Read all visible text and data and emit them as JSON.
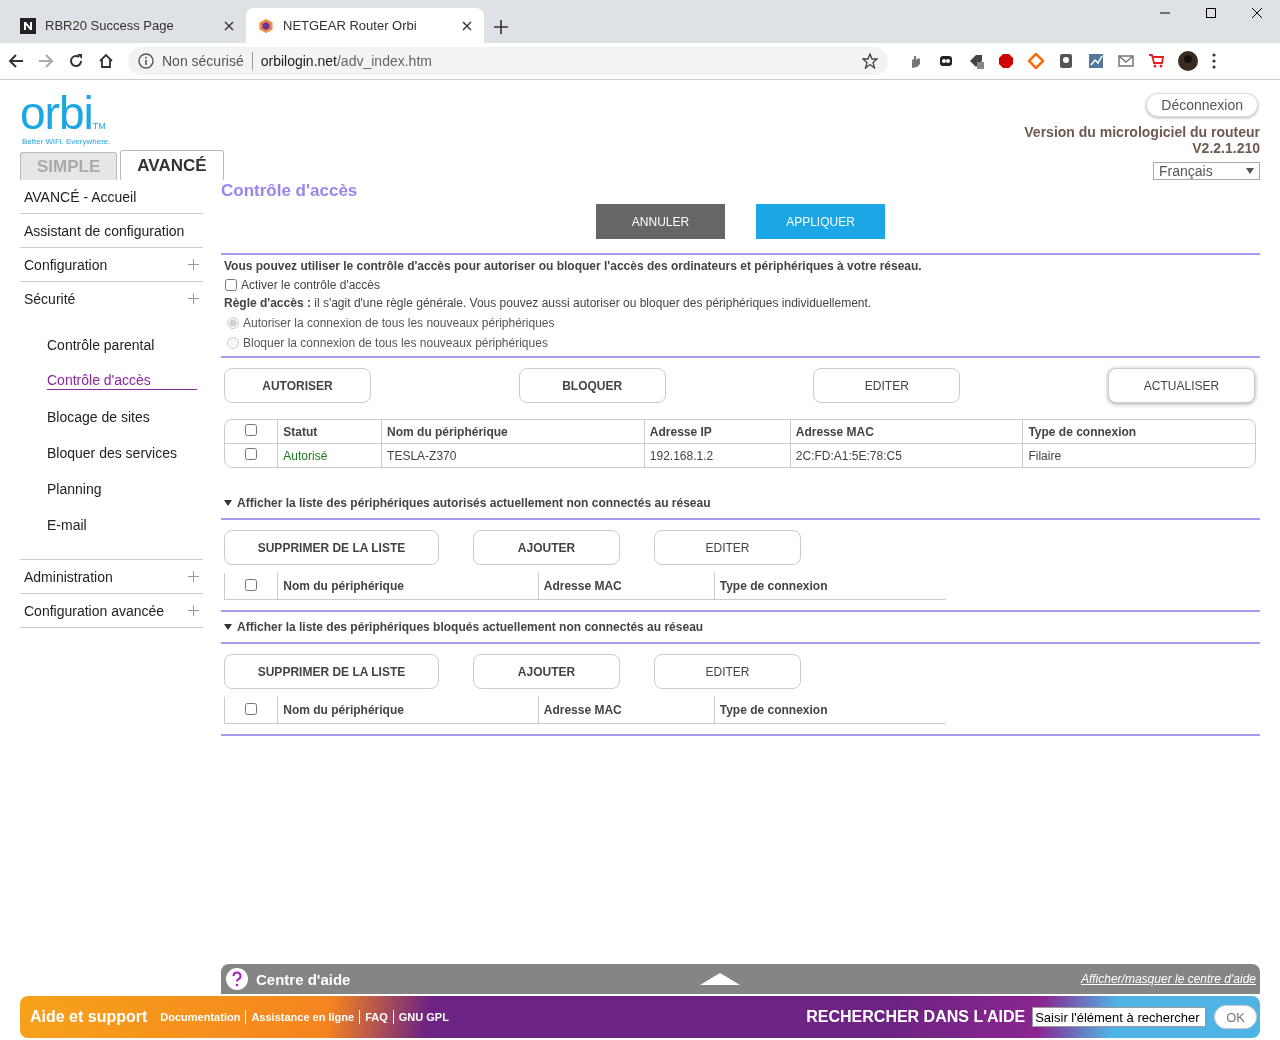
{
  "browser": {
    "tabs": [
      {
        "title": "RBR20 Success Page",
        "selected": false
      },
      {
        "title": "NETGEAR Router Orbi",
        "selected": true
      }
    ],
    "address": {
      "security": "Non sécurisé",
      "host": "orbilogin.net",
      "path": "/adv_index.htm"
    }
  },
  "header": {
    "logo": "orbi",
    "trademark": "TM",
    "tagline": "Better WiFi. Everywhere.",
    "logout": "Déconnexion",
    "firmware_label": "Version du micrologiciel du routeur",
    "firmware_version": "V2.2.1.210",
    "language": "Français"
  },
  "mode_tabs": [
    {
      "label": "SIMPLE",
      "selected": false
    },
    {
      "label": "AVANCÉ",
      "selected": true
    }
  ],
  "sidebar": {
    "items": [
      {
        "label": "AVANCÉ - Accueil",
        "expandable": false,
        "selected": false
      },
      {
        "label": "Assistant de configuration",
        "expandable": false,
        "selected": false
      },
      {
        "label": "Configuration",
        "expandable": true,
        "selected": false
      },
      {
        "label": "Sécurité",
        "expandable": true,
        "selected": false,
        "children": [
          {
            "label": "Contrôle parental",
            "selected": false
          },
          {
            "label": "Contrôle d'accès",
            "selected": true
          },
          {
            "label": "Blocage de sites",
            "selected": false
          },
          {
            "label": "Bloquer des services",
            "selected": false
          },
          {
            "label": "Planning",
            "selected": false
          },
          {
            "label": "E-mail",
            "selected": false
          }
        ]
      },
      {
        "label": "Administration",
        "expandable": true,
        "selected": false
      },
      {
        "label": "Configuration avancée",
        "expandable": true,
        "selected": false
      }
    ]
  },
  "main": {
    "title": "Contrôle d'accès",
    "top_buttons": [
      {
        "label": "ANNULER",
        "kind": "dark"
      },
      {
        "label": "APPLIQUER",
        "kind": "primary"
      }
    ],
    "intro": "Vous pouvez utiliser le contrôle d'accès pour autoriser ou bloquer l'accès des ordinateurs et périphériques à votre réseau.",
    "enable": {
      "label": "Activer le contrôle d'accès",
      "checked": false
    },
    "rule": "**Règle d'accès :** il s'agit d'une règle générale. Vous pouvez aussi autoriser ou bloquer des périphériques individuellement.",
    "rule_options": [
      {
        "label": "Autoriser la connexion de tous les nouveaux périphériques",
        "selected": true,
        "disabled": true
      },
      {
        "label": "Bloquer la connexion de tous les nouveaux périphériques",
        "selected": false,
        "disabled": true
      }
    ],
    "action_buttons": [
      "AUTORISER",
      "BLOQUER",
      "EDITER",
      "ACTUALISER"
    ],
    "devices": {
      "select_all_checked": false,
      "columns": [
        "Statut",
        "Nom du périphérique",
        "Adresse IP",
        "Adresse MAC",
        "Type de connexion"
      ],
      "rows": [
        {
          "checked": false,
          "cells": [
            "Autorisé",
            "TESLA-Z370",
            "192.168.1.2",
            "2C:FD:A1:5E:78:C5",
            "Filaire"
          ]
        }
      ]
    },
    "sections": [
      {
        "title": "Afficher la liste des périphériques autorisés actuellement non connectés au réseau",
        "expanded": true,
        "select_all_checked": false,
        "buttons": [
          "SUPPRIMER DE LA LISTE",
          "AJOUTER",
          "EDITER"
        ],
        "columns": [
          "Nom du périphérique",
          "Adresse MAC",
          "Type de connexion"
        ]
      },
      {
        "title": "Afficher la liste des périphériques bloqués actuellement non connectés au réseau",
        "expanded": true,
        "select_all_checked": false,
        "buttons": [
          "SUPPRIMER DE LA LISTE",
          "AJOUTER",
          "EDITER"
        ],
        "columns": [
          "Nom du périphérique",
          "Adresse MAC",
          "Type de connexion"
        ]
      }
    ]
  },
  "help_bar": {
    "title": "Centre d'aide",
    "toggle": "Afficher/masquer le centre d'aide"
  },
  "footer": {
    "title": "Aide et support",
    "links": [
      "Documentation",
      "Assistance en ligne",
      "FAQ",
      "GNU GPL"
    ],
    "search_label": "RECHERCHER DANS L'AIDE",
    "search_value": "Saisir l'élément à rechercher",
    "ok": "OK"
  }
}
